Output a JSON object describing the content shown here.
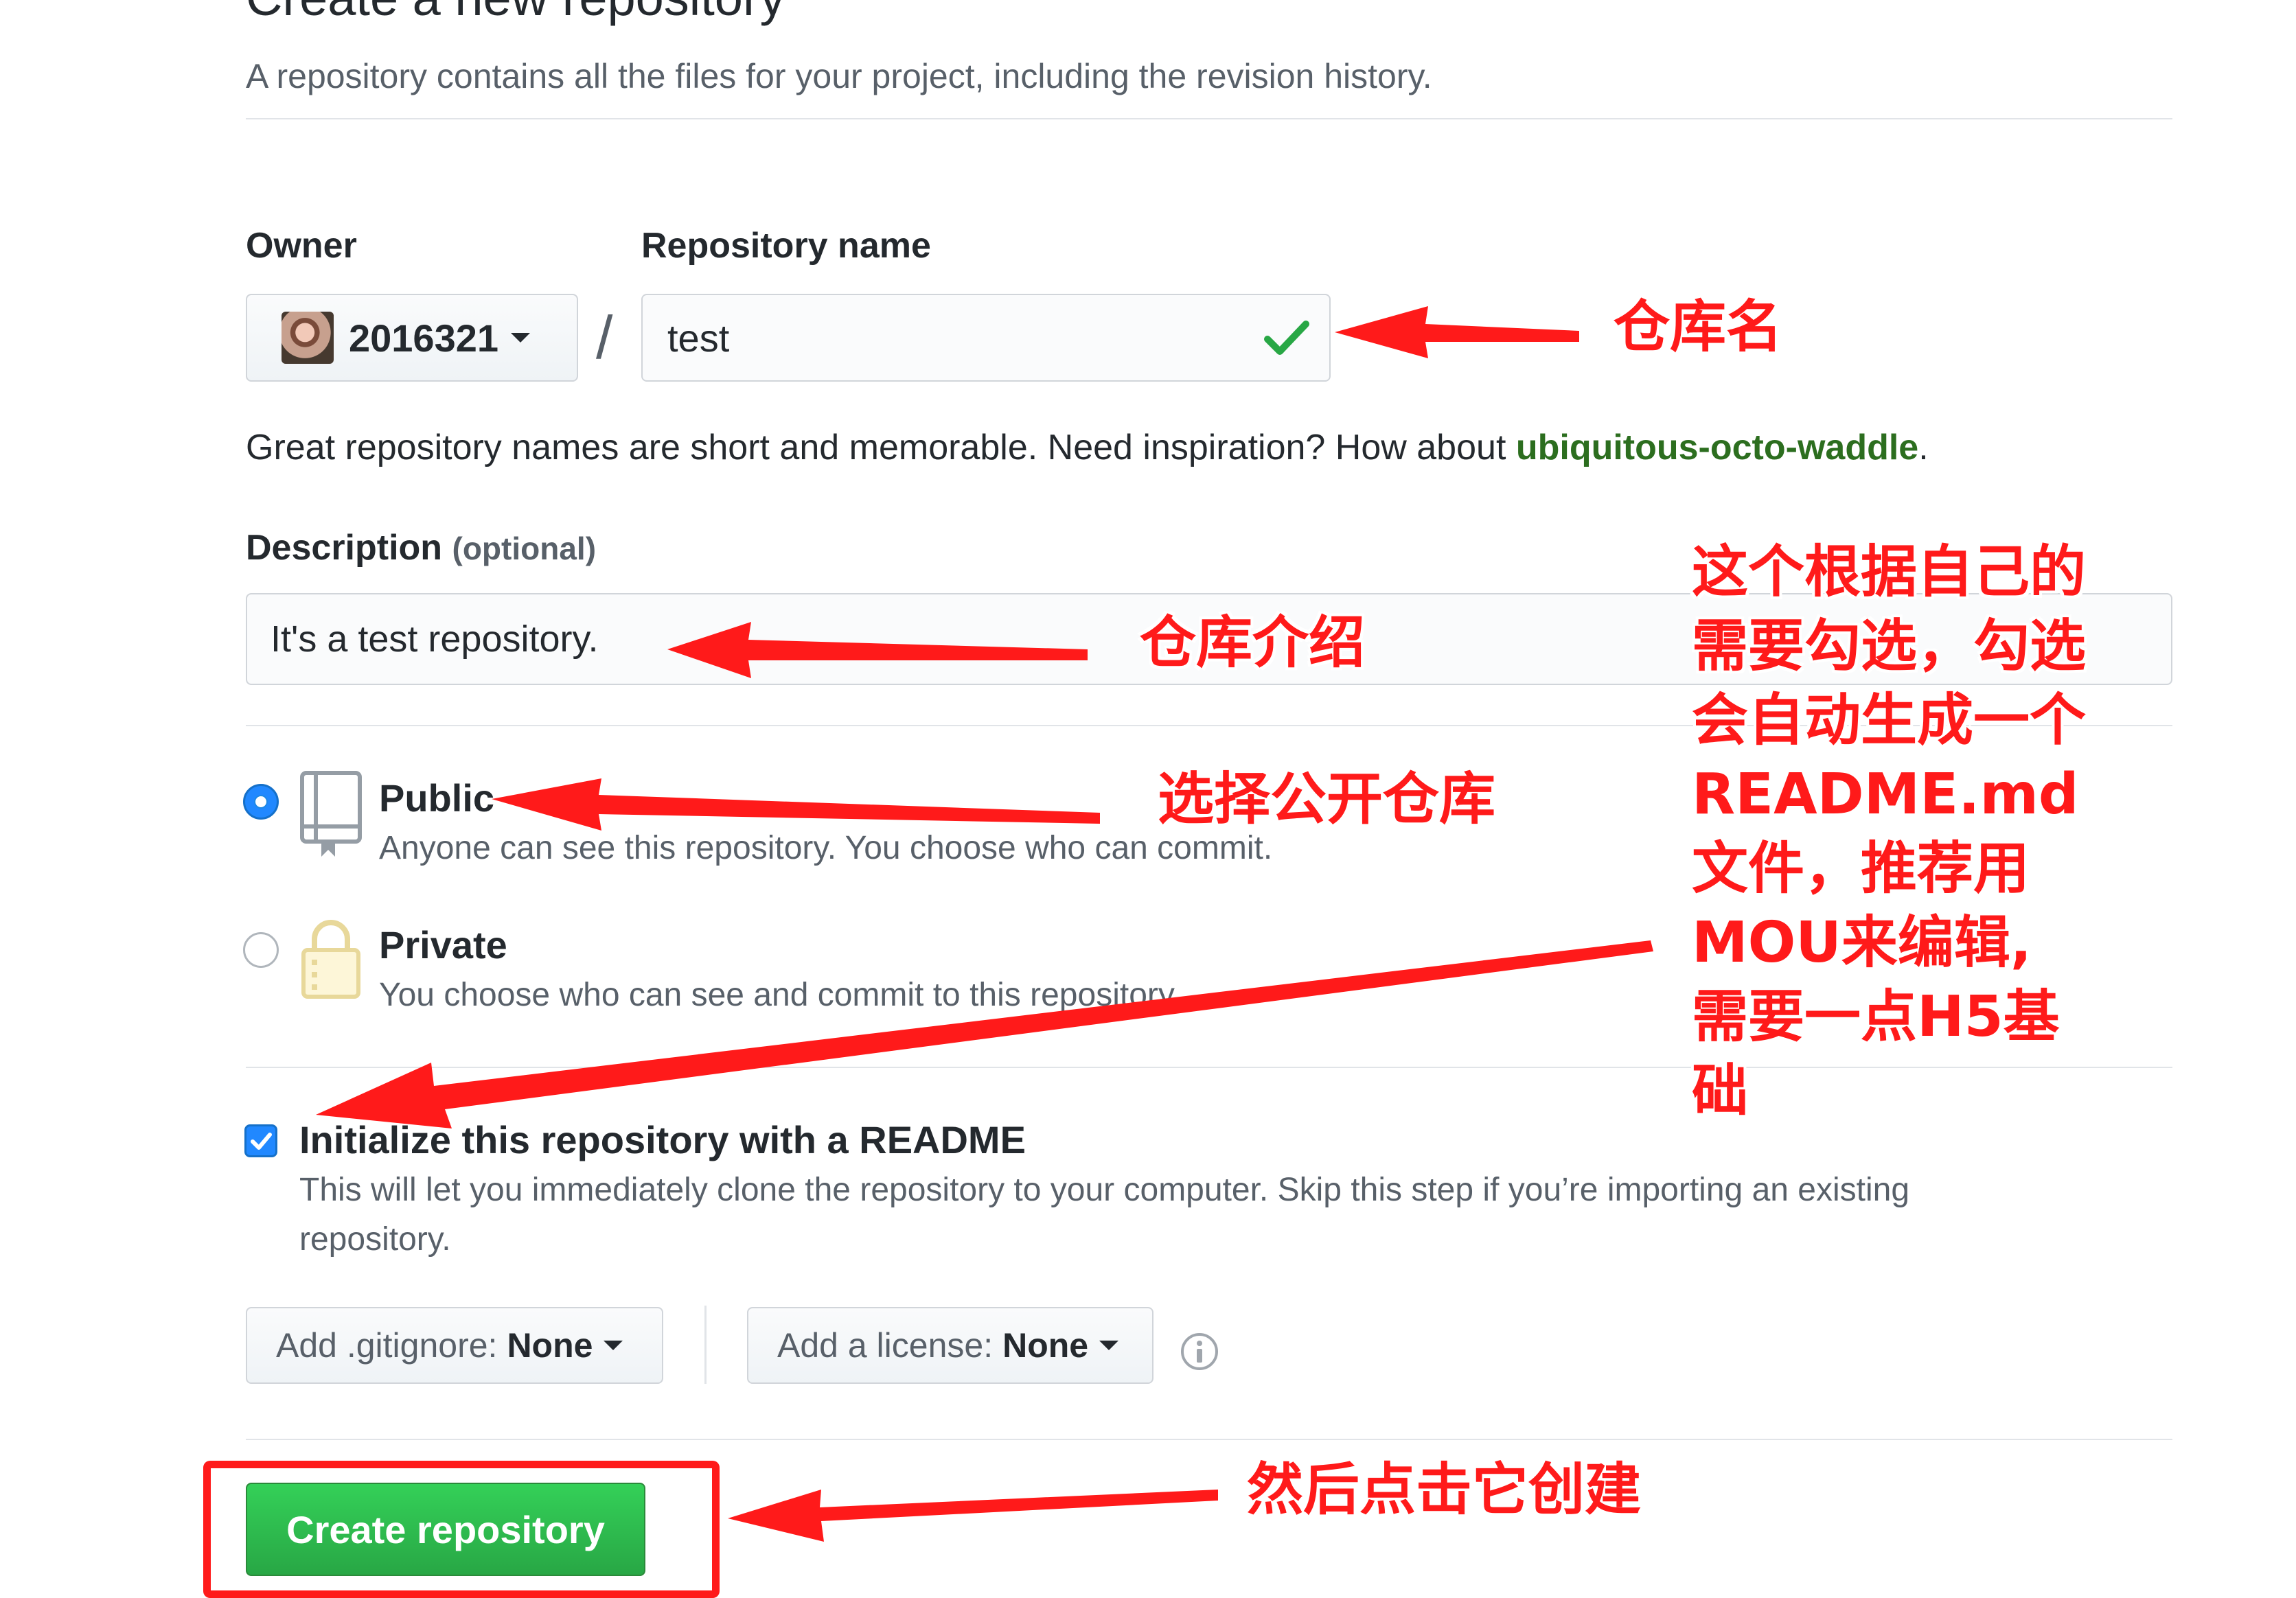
{
  "header": {
    "title": "Create a new repository",
    "subtitle": "A repository contains all the files for your project, including the revision history."
  },
  "owner": {
    "label": "Owner",
    "value": "2016321"
  },
  "repo_name": {
    "label": "Repository name",
    "value": "test",
    "hint_prefix": "Great repository names are short and memorable. Need inspiration? How about ",
    "suggestion": "ubiquitous-octo-waddle",
    "hint_suffix": "."
  },
  "description": {
    "label": "Description",
    "optional": "(optional)",
    "value": "It's a test repository."
  },
  "visibility": {
    "public_title": "Public",
    "public_desc": "Anyone can see this repository. You choose who can commit.",
    "private_title": "Private",
    "private_desc": "You choose who can see and commit to this repository.",
    "selected": "public"
  },
  "readme": {
    "checked": true,
    "label": "Initialize this repository with a README",
    "desc_line1": "This will let you immediately clone the repository to your computer. Skip this step if you’re importing an existing",
    "desc_line2": "repository."
  },
  "gitignore": {
    "prefix": "Add .gitignore:",
    "value": "None"
  },
  "license": {
    "prefix": "Add a license:",
    "value": "None"
  },
  "submit": {
    "label": "Create repository"
  },
  "annotations": {
    "repo_name": "仓库名",
    "description": "仓库介绍",
    "public": "选择公开仓库",
    "readme_lines": [
      "这个根据自己的",
      "需要勾选，勾选",
      "会自动生成一个",
      "README.md",
      "文件，推荐用",
      "MOU来编辑,",
      "需要一点H5基",
      "础"
    ],
    "create": "然后点击它创建"
  },
  "colors": {
    "accent_green": "#28a745",
    "annotation_red": "#ff1a1a",
    "radio_blue": "#2188ff"
  }
}
